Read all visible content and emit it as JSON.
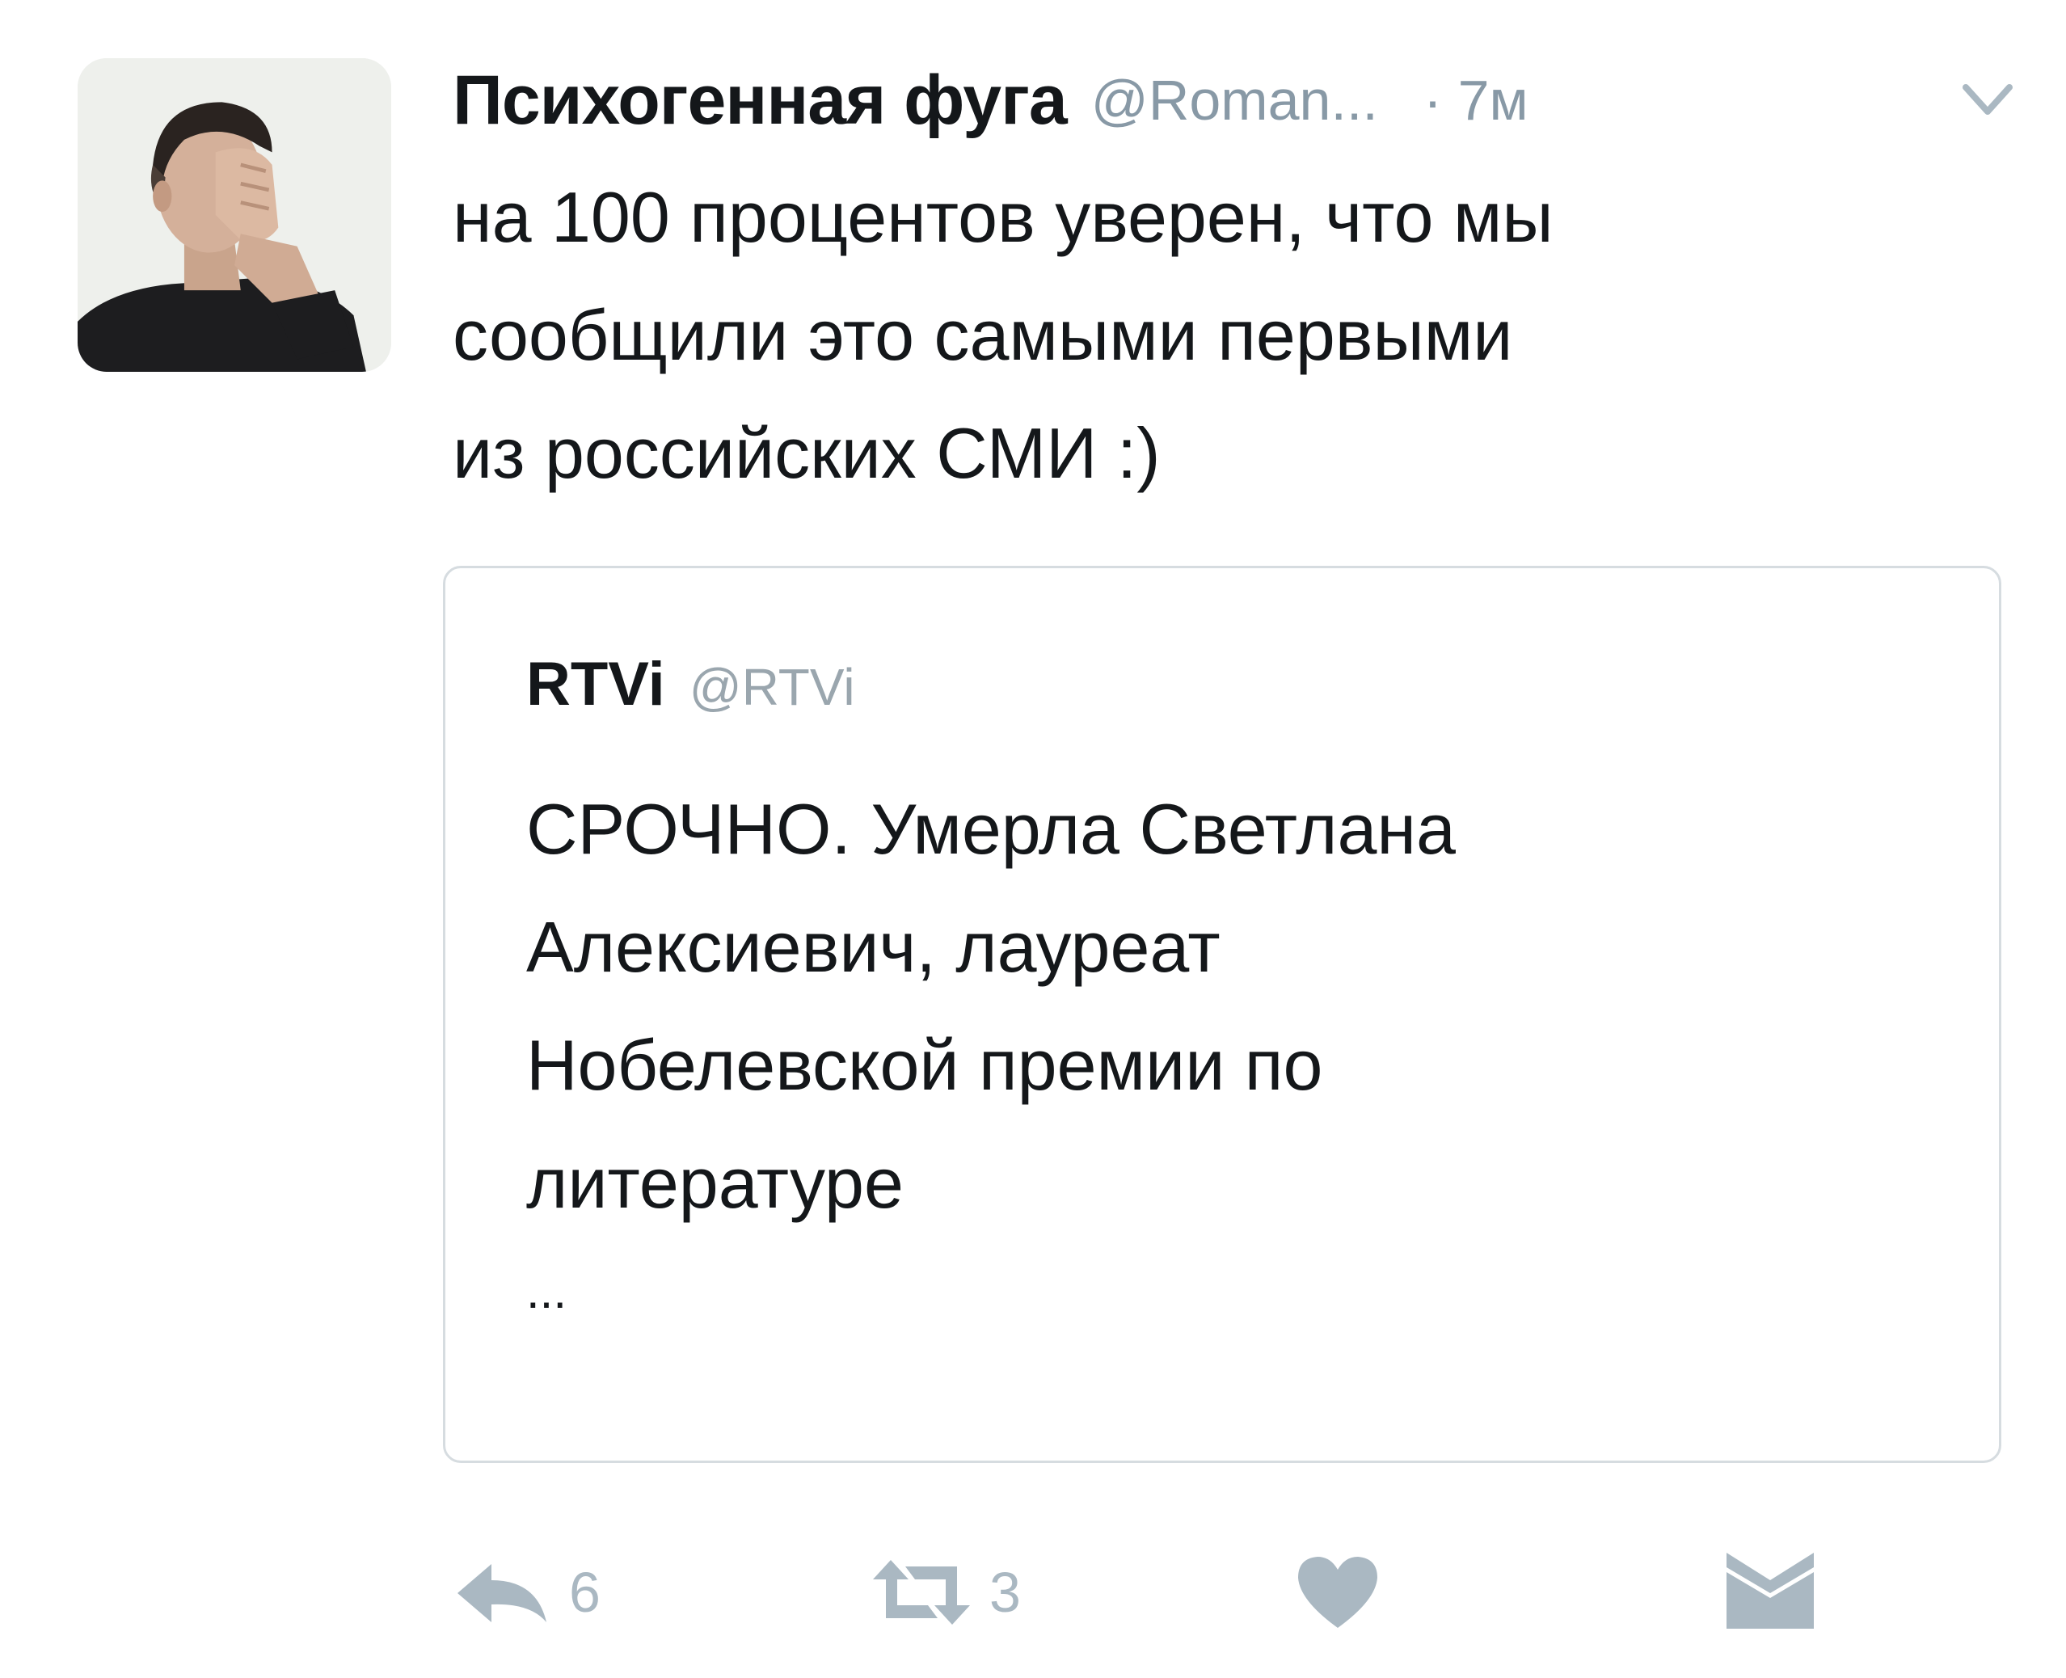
{
  "tweet": {
    "display_name": "Психогенная фуга",
    "username": "@Roman...",
    "timestamp": "· 7м",
    "text_lines": [
      "на 100 процентов уверен, что мы",
      "сообщили это самыми первыми",
      "из российских СМИ :)"
    ]
  },
  "quoted_tweet": {
    "display_name": "RTVi",
    "username": "@RTVi",
    "text_lines": [
      "СРОЧНО. Умерла Светлана",
      "Алексиевич, лауреат",
      "Нобелевской премии по",
      "литературе"
    ],
    "ellipsis": "..."
  },
  "actions": {
    "reply_count": "6",
    "retweet_count": "3"
  },
  "icons": {
    "reply": "reply-icon",
    "retweet": "retweet-icon",
    "like": "heart-icon",
    "message": "envelope-icon",
    "menu": "chevron-down-icon"
  },
  "colors": {
    "text": "#14171a",
    "secondary": "#8899a6",
    "icon": "#aab8c2",
    "border": "#d6dce0"
  }
}
